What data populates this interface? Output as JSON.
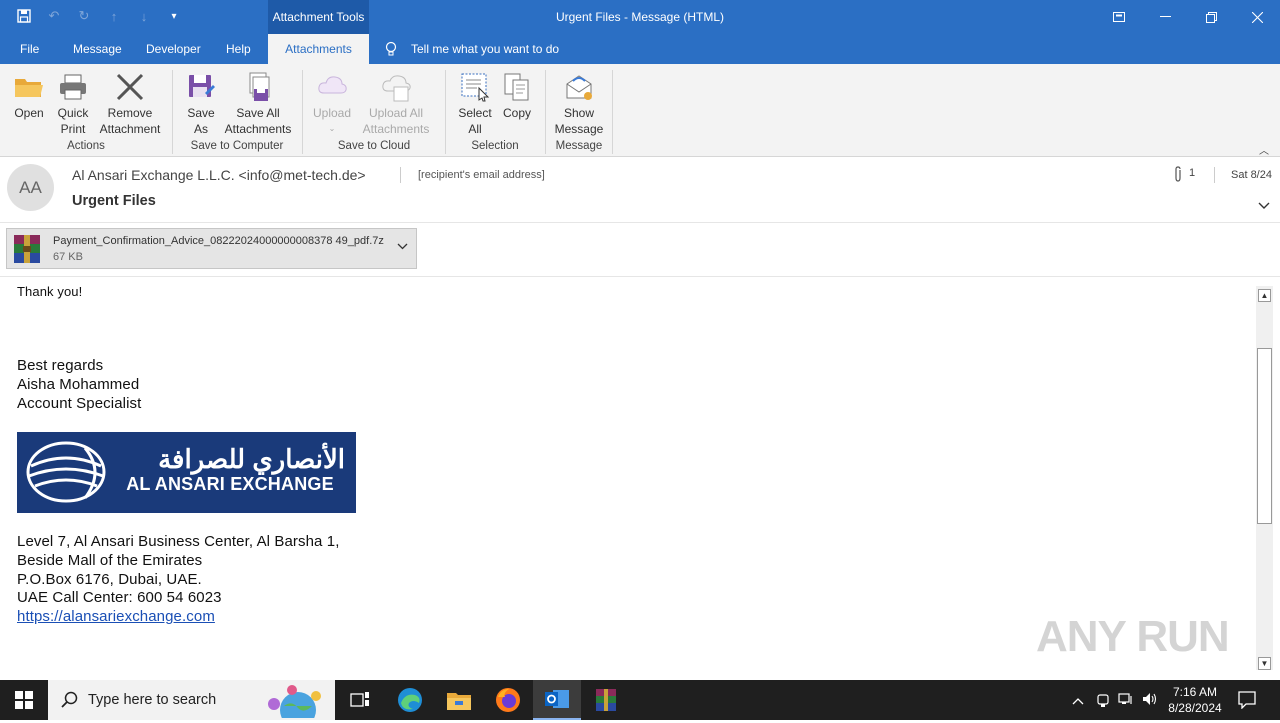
{
  "window": {
    "title": "Urgent Files  -  Message (HTML)",
    "context_tools": "Attachment Tools"
  },
  "tabs": [
    {
      "label": "File"
    },
    {
      "label": "Message"
    },
    {
      "label": "Developer"
    },
    {
      "label": "Help"
    },
    {
      "label": "Attachments"
    }
  ],
  "tell_me": "Tell me what you want to do",
  "ribbon": {
    "open": "Open",
    "quick_print_1": "Quick",
    "quick_print_2": "Print",
    "remove_1": "Remove",
    "remove_2": "Attachment",
    "group_actions": "Actions",
    "save_as_1": "Save",
    "save_as_2": "As",
    "save_all_1": "Save All",
    "save_all_2": "Attachments",
    "group_save_computer": "Save to Computer",
    "upload": "Upload",
    "upload_all_1": "Upload All",
    "upload_all_2": "Attachments",
    "group_save_cloud": "Save to Cloud",
    "select_all_1": "Select",
    "select_all_2": "All",
    "copy": "Copy",
    "group_selection": "Selection",
    "show_msg_1": "Show",
    "show_msg_2": "Message",
    "group_message": "Message"
  },
  "header": {
    "avatar": "AA",
    "sender": "Al Ansari Exchange L.L.C.  <info@met-tech.de>",
    "recipient": "[recipient's email address]",
    "subject": "Urgent Files",
    "attachment_count": "1",
    "date": "Sat 8/24"
  },
  "attachment": {
    "name": "Payment_Confirmation_Advice_08222024000000008378 49_pdf.7z",
    "size": "67 KB"
  },
  "body": {
    "thanks": "Thank you!",
    "regards": "Best regards",
    "name": "Aisha Mohammed",
    "role": "Account Specialist",
    "logo_ar": "الأنصاري للصرافة",
    "logo_en": "AL ANSARI EXCHANGE",
    "addr1": "Level 7, Al Ansari Business Center, Al Barsha 1,",
    "addr2": "Beside Mall of the Emirates",
    "addr3": "P.O.Box 6176, Dubai, UAE.",
    "call": "UAE Call Center: 600 54 6023",
    "link": "https://alansariexchange.com"
  },
  "watermark": "ANY RUN",
  "taskbar": {
    "search_placeholder": "Type here to search",
    "time": "7:16 AM",
    "date": "8/28/2024"
  }
}
